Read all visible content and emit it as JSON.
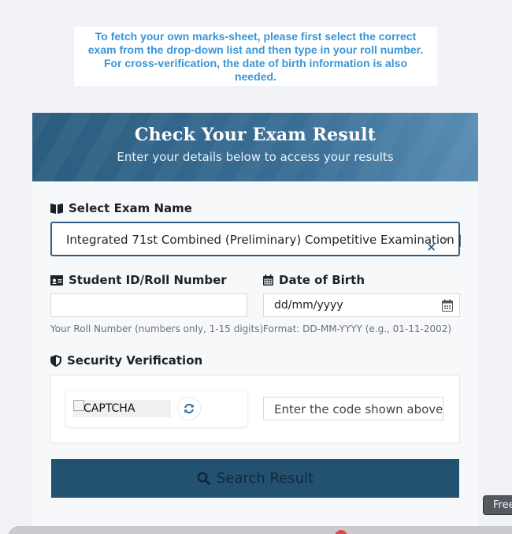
{
  "notice": {
    "text": "To fetch your own marks-sheet, please first select the correct exam from the drop-down list and then type in your roll number. For cross-verification, the date of birth information is also needed."
  },
  "card": {
    "title": "Check Your Exam Result",
    "subtitle": "Enter your details below to access your results"
  },
  "form": {
    "exam_label": "Select Exam Name",
    "exam_value": "Integrated 71st Combined (Preliminary) Competitive Examination |",
    "exam_clear": "×",
    "roll_label": "Student ID/Roll Number",
    "roll_value": "",
    "roll_hint": "Your Roll Number (numbers only, 1-15 digits)",
    "dob_label": "Date of Birth",
    "dob_placeholder": "dd/mm/yyyy",
    "dob_hint": "Format: DD-MM-YYYY (e.g., 01-11-2002)",
    "security_label": "Security Verification",
    "captcha_alt": "CAPTCHA",
    "captcha_placeholder": "Enter the code shown above",
    "search_label": "Search Result"
  },
  "tooltip": {
    "text": "Free"
  },
  "colors": {
    "notice_text": "#3a95d6",
    "header_bg": "#2c5d80",
    "select_border": "#2e5e88",
    "button_bg": "#235270"
  },
  "icons": {
    "exam": "book-open-icon",
    "roll": "id-card-icon",
    "dob": "calendar-icon",
    "security": "shield-icon",
    "refresh": "refresh-icon",
    "search": "search-icon"
  }
}
